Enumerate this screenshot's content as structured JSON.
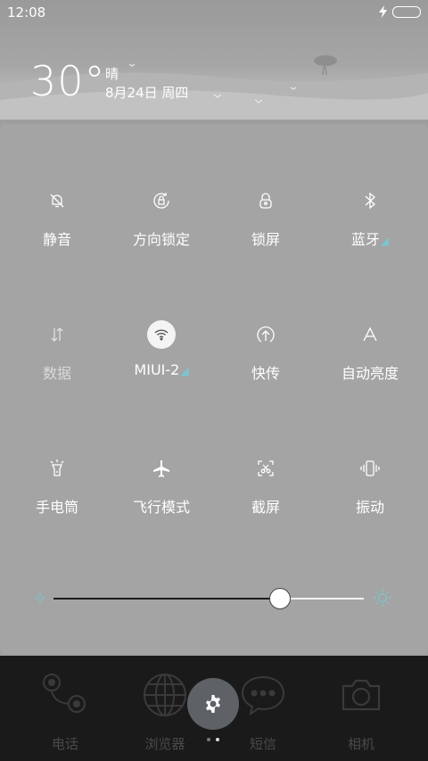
{
  "status_bar": {
    "time": "12:08"
  },
  "weather": {
    "temperature": "30°",
    "condition": "晴",
    "date": "8月24日 周四"
  },
  "toggles": [
    {
      "label": "静音",
      "icon": "mute-bell-icon",
      "active": false
    },
    {
      "label": "方向锁定",
      "icon": "rotation-lock-icon",
      "active": false
    },
    {
      "label": "锁屏",
      "icon": "lock-icon",
      "active": false
    },
    {
      "label": "蓝牙",
      "icon": "bluetooth-icon",
      "active": false
    },
    {
      "label": "数据",
      "icon": "mobile-data-icon",
      "active": false
    },
    {
      "label": "MIUI-2",
      "icon": "wifi-icon",
      "active": true
    },
    {
      "label": "快传",
      "icon": "quick-transfer-icon",
      "active": false
    },
    {
      "label": "自动亮度",
      "icon": "auto-brightness-icon",
      "active": false
    },
    {
      "label": "手电筒",
      "icon": "flashlight-icon",
      "active": false
    },
    {
      "label": "飞行模式",
      "icon": "airplane-icon",
      "active": false
    },
    {
      "label": "截屏",
      "icon": "screenshot-icon",
      "active": false
    },
    {
      "label": "振动",
      "icon": "vibrate-icon",
      "active": false
    }
  ],
  "brightness": {
    "level": 0.73
  },
  "dock": [
    {
      "label": "电话",
      "icon": "phone-icon"
    },
    {
      "label": "浏览器",
      "icon": "browser-globe-icon"
    },
    {
      "label": "短信",
      "icon": "messages-icon"
    },
    {
      "label": "相机",
      "icon": "camera-icon"
    }
  ],
  "colors": {
    "accent_tick": "#79c7d0",
    "panel": "#a4a4a4",
    "dock": "#1a1a1a"
  }
}
